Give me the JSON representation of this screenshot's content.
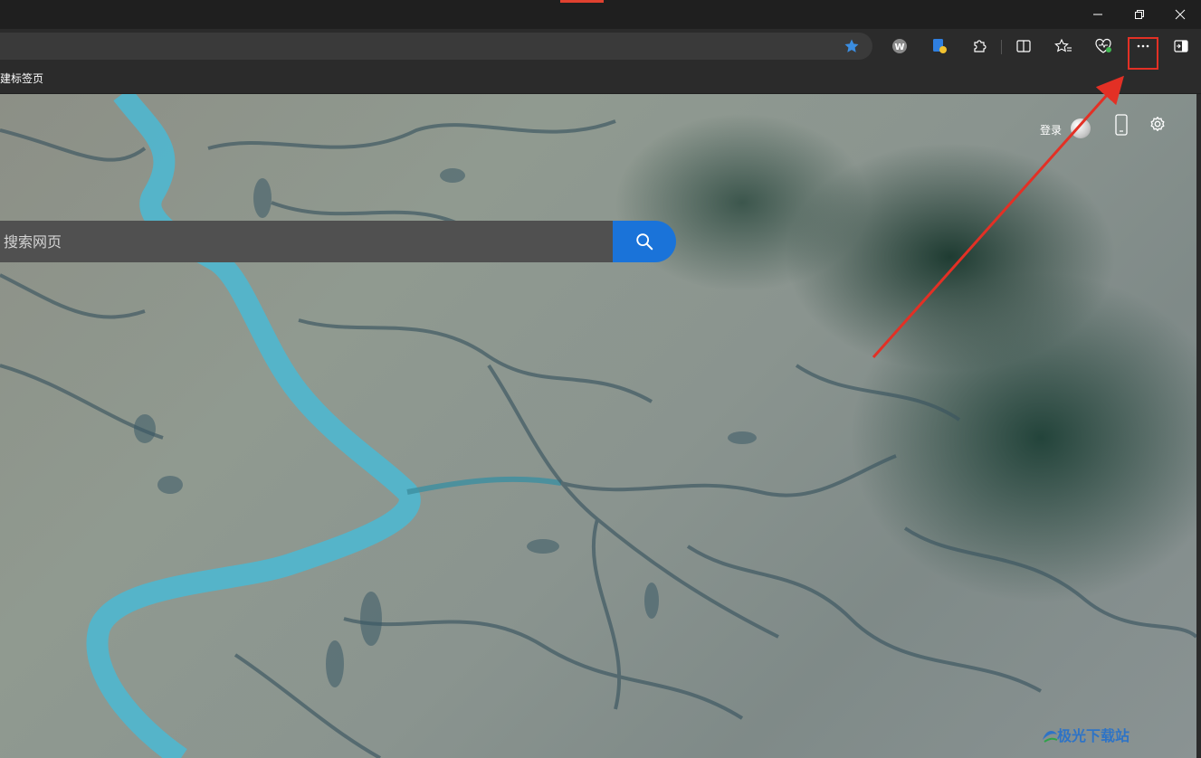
{
  "titlebar": {
    "accent_color": "#e0412f",
    "window_buttons": [
      "minimize-icon",
      "restore-icon",
      "close-icon"
    ]
  },
  "toolbar": {
    "favorite_star_color": "#3b8de0",
    "icons": [
      "w-extension-icon",
      "edge-extension-icon",
      "extensions-icon",
      "split-screen-icon",
      "favorites-icon",
      "browser-essentials-icon",
      "more-options-icon",
      "sidebar-icon"
    ]
  },
  "bookmarks_bar": {
    "items": [
      {
        "label": "建标签页"
      }
    ]
  },
  "header": {
    "login_label": "登录"
  },
  "search": {
    "placeholder": "搜索网页",
    "button_color": "#1a73d9"
  },
  "annotation": {
    "highlight_color": "#e33025",
    "arrow_color": "#e33025"
  },
  "watermark": {
    "text": "极光下载站"
  }
}
